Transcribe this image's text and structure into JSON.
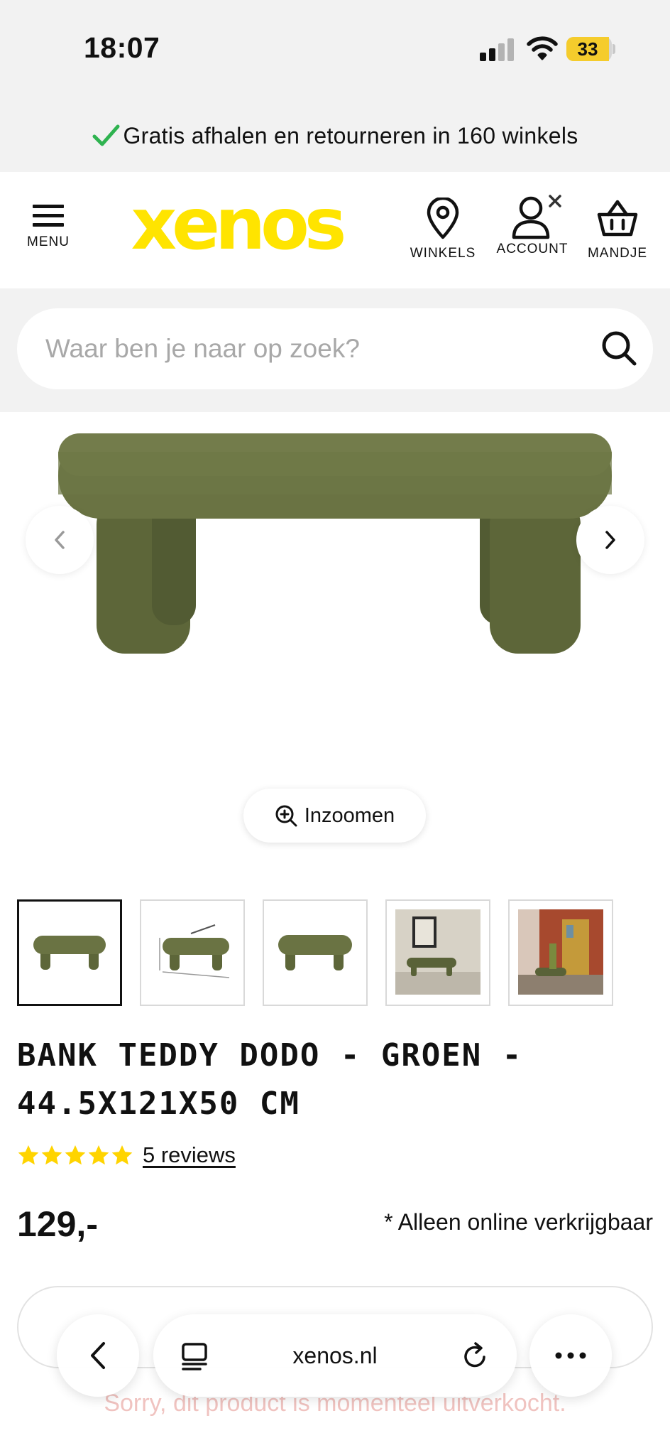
{
  "status_bar": {
    "time": "18:07",
    "battery": "33",
    "battery_level": 0.33
  },
  "promo": {
    "text": "Gratis afhalen en retourneren in 160 winkels"
  },
  "header": {
    "menu_label": "MENU",
    "logo_text": "xenos",
    "nav": [
      {
        "label": "WINKELS",
        "icon": "location-pin-icon"
      },
      {
        "label": "ACCOUNT",
        "icon": "user-icon"
      },
      {
        "label": "MANDJE",
        "icon": "basket-icon"
      }
    ]
  },
  "search": {
    "placeholder": "Waar ben je naar op zoek?",
    "value": ""
  },
  "gallery": {
    "zoom_label": "Inzoomen",
    "thumbnail_count": 5,
    "active_thumbnail": 1
  },
  "product": {
    "title_line1": "BANK TEDDY DODO - GROEN -",
    "title_line2": "44.5X121X50 CM",
    "rating": 5,
    "reviews_label": "5 reviews",
    "price": "129,-",
    "availability_note": "* Alleen online verkrijgbaar",
    "soldout_message": "Sorry, dit product is momenteel uitverkocht."
  },
  "browser": {
    "url": "xenos.nl"
  },
  "colors": {
    "brand_yellow": "#ffe400",
    "check_green": "#2fb350",
    "bench_green": "#626b3f",
    "star_yellow": "#ffd400"
  }
}
